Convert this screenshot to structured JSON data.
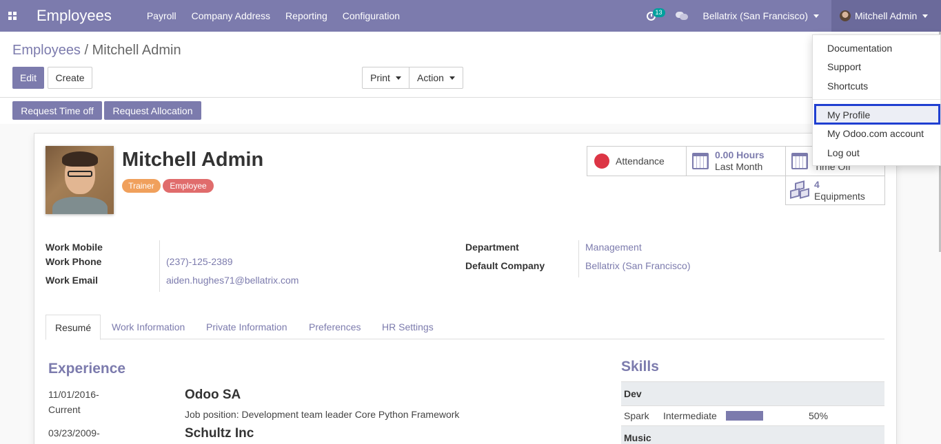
{
  "navbar": {
    "app_title": "Employees",
    "menu": [
      "Payroll",
      "Company Address",
      "Reporting",
      "Configuration"
    ],
    "activity_count": "13",
    "company": "Bellatrix (San Francisco)",
    "user": "Mitchell Admin",
    "accent": "#7c7bad"
  },
  "breadcrumb": {
    "parent": "Employees",
    "separator": "/",
    "current": "Mitchell Admin"
  },
  "buttons": {
    "edit": "Edit",
    "create": "Create",
    "print": "Print",
    "action": "Action",
    "request_time_off": "Request Time off",
    "request_allocation": "Request Allocation"
  },
  "employee": {
    "name": "Mitchell Admin",
    "tags": [
      "Trainer",
      "Employee"
    ],
    "work_mobile_label": "Work Mobile",
    "work_phone_label": "Work Phone",
    "work_phone": "(237)-125-2389",
    "work_email_label": "Work Email",
    "work_email": "aiden.hughes71@bellatrix.com",
    "department_label": "Department",
    "department": "Management",
    "company_label": "Default Company",
    "company": "Bellatrix (San Francisco)"
  },
  "stats": {
    "attendance": "Attendance",
    "hours_value": "0.00 Hours",
    "hours_label": "Last Month",
    "timeoff_label": "Time Off",
    "equipments_value": "4",
    "equipments_label": "Equipments"
  },
  "tabs": [
    "Resumé",
    "Work Information",
    "Private Information",
    "Preferences",
    "HR Settings"
  ],
  "resume": {
    "heading": "Experience",
    "entries": [
      {
        "date1": "11/01/2016-",
        "date2": "Current",
        "company": "Odoo SA",
        "job": "Job position: Development team leader Core Python Framework"
      },
      {
        "date1": "03/23/2009-",
        "company": "Schultz Inc"
      }
    ]
  },
  "skills": {
    "heading": "Skills",
    "groups": [
      {
        "name": "Dev",
        "rows": [
          {
            "skill": "Spark",
            "level": "Intermediate",
            "progress": "50%"
          }
        ]
      },
      {
        "name": "Music"
      }
    ]
  },
  "user_dropdown": {
    "items": [
      "Documentation",
      "Support",
      "Shortcuts",
      "My Profile",
      "My Odoo.com account",
      "Log out"
    ],
    "highlighted": "My Profile"
  }
}
